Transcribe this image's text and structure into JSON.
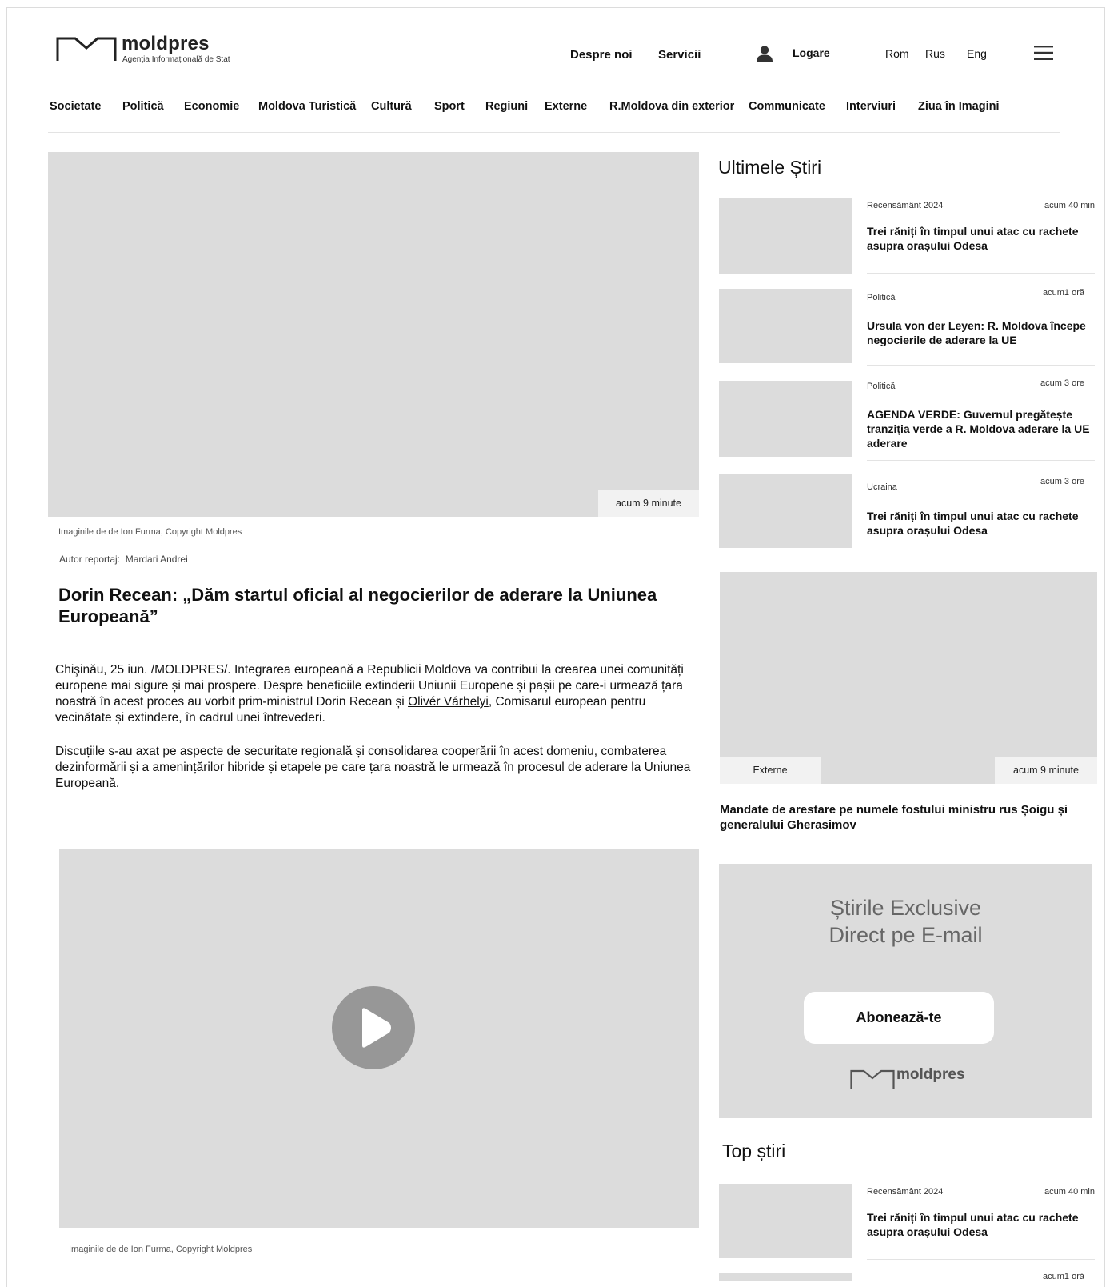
{
  "header": {
    "logo_name": "moldpres",
    "logo_tagline": "Agenția Informațională de Stat",
    "links": [
      "Despre noi",
      "Servicii"
    ],
    "login_label": "Logare",
    "languages": [
      "Rom",
      "Rus",
      "Eng"
    ],
    "icons": {
      "user": "user-icon",
      "menu": "hamburger-menu-icon"
    }
  },
  "nav": [
    "Societate",
    "Politică",
    "Economie",
    "Moldova Turistică",
    "Cultură",
    "Sport",
    "Regiuni",
    "Externe",
    "R.Moldova din exterior",
    "Communicate",
    "Interviuri",
    "Ziua în Imagini"
  ],
  "article": {
    "hero_time": "acum 9 minute",
    "image_credit": "Imaginile de  de Ion Furma, Copyright Moldpres",
    "author_label": "Autor reportaj:",
    "author_name": "Mardari Andrei",
    "title": "Dorin Recean: „Dăm startul oficial al negocierilor de aderare la Uniunea Europeană”",
    "p1_text": "Chişinău, 25 iun. /MOLDPRES/. Integrarea europeană a Republicii Moldova va contribui la crearea unei comunități europene mai sigure și mai prospere. Despre beneficiile extinderii Uniunii Europene și pașii pe care-i urmează țara noastră în acest proces au vorbit prim-ministrul Dorin Recean și ",
    "p1_link": "Olivér Várhelyi",
    "p1_tail": ", Comisarul european pentru vecinătate și extindere, în cadrul unei întrevederi.",
    "p2": "Discuțiile s-au axat pe aspecte de securitate regională și consolidarea cooperării în acest domeniu, combaterea dezinformării și a amenințărilor hibride și etapele pe care țara noastră le urmează în procesul de aderare la Uniunea Europeană.",
    "video_credit": "Imaginile de  de Ion Furma, Copyright Moldpres",
    "video_icon": "play-icon"
  },
  "sidebar": {
    "latest_title": "Ultimele Știri",
    "latest": [
      {
        "category": "Recensământ 2024",
        "time": "acum 40 min",
        "headline": "Trei răniți în timpul unui atac cu rachete asupra orașului Odesa"
      },
      {
        "category": "Politică",
        "time": "acum1 oră",
        "headline": "Ursula von der Leyen: R. Moldova începe negocierile de aderare la UE"
      },
      {
        "category": "Politică",
        "time": "acum 3 ore",
        "headline": "AGENDA VERDE: Guvernul pregătește tranziția verde a R. Moldova aderare la UE aderare"
      },
      {
        "category": "Ucraina",
        "time": "acum 3 ore",
        "headline": "Trei răniți în timpul unui atac cu rachete asupra orașului Odesa"
      }
    ],
    "featured": {
      "category": "Externe",
      "time": "acum 9 minute",
      "headline": "Mandate de arestare pe numele fostului ministru rus Șoigu și generalului Gherasimov"
    },
    "subscribe": {
      "line1": "Știrile Exclusive",
      "line2": "Direct pe E-mail",
      "button": "Abonează-te",
      "logo_name": "moldpres"
    },
    "top_title": "Top știri",
    "top": [
      {
        "category": "Recensământ 2024",
        "time": "acum 40 min",
        "headline": "Trei răniți în timpul unui atac cu rachete asupra orașului Odesa"
      },
      {
        "category": "",
        "time": "acum1 oră",
        "headline": ""
      }
    ]
  }
}
